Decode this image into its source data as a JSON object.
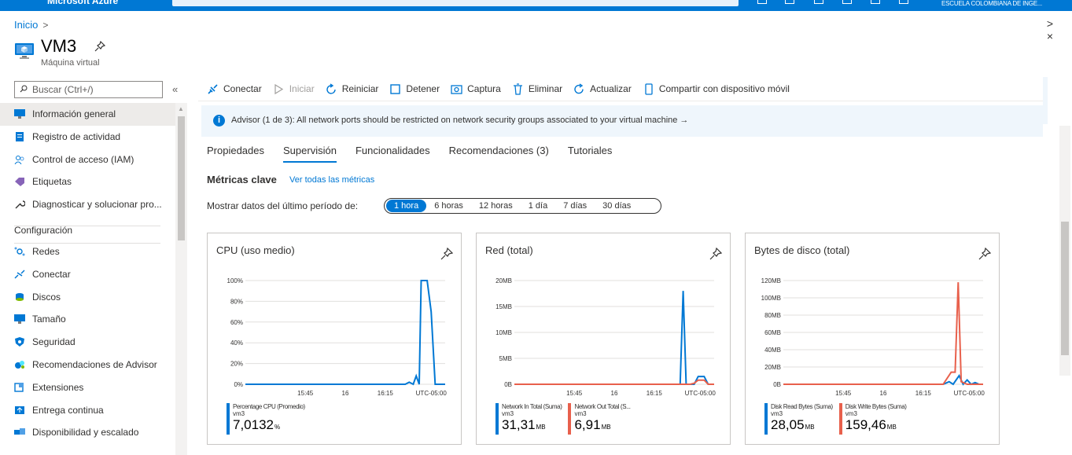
{
  "topbar": {
    "brand": "Microsoft Azure",
    "org": "ESCUELA COLOMBIANA DE INGE..."
  },
  "breadcrumb": {
    "home": "Inicio"
  },
  "header": {
    "title": "VM3",
    "subtitle": "Máquina virtual"
  },
  "sidebar": {
    "search_placeholder": "Buscar (Ctrl+/)",
    "items": [
      {
        "label": "Información general",
        "icon": "monitor-icon"
      },
      {
        "label": "Registro de actividad",
        "icon": "log-icon"
      },
      {
        "label": "Control de acceso (IAM)",
        "icon": "people-icon"
      },
      {
        "label": "Etiquetas",
        "icon": "tag-icon"
      },
      {
        "label": "Diagnosticar y solucionar pro...",
        "icon": "wrench-icon"
      }
    ],
    "section": "Configuración",
    "config_items": [
      {
        "label": "Redes",
        "icon": "network-icon"
      },
      {
        "label": "Conectar",
        "icon": "connect-icon"
      },
      {
        "label": "Discos",
        "icon": "disks-icon"
      },
      {
        "label": "Tamaño",
        "icon": "size-icon"
      },
      {
        "label": "Seguridad",
        "icon": "shield-icon"
      },
      {
        "label": "Recomendaciones de Advisor",
        "icon": "advisor-icon"
      },
      {
        "label": "Extensiones",
        "icon": "extensions-icon"
      },
      {
        "label": "Entrega continua",
        "icon": "delivery-icon"
      },
      {
        "label": "Disponibilidad y escalado",
        "icon": "scale-icon"
      }
    ]
  },
  "toolbar": {
    "connect": "Conectar",
    "start": "Iniciar",
    "restart": "Reiniciar",
    "stop": "Detener",
    "capture": "Captura",
    "delete": "Eliminar",
    "refresh": "Actualizar",
    "share": "Compartir con dispositivo móvil"
  },
  "banner": {
    "text": "Advisor (1 de 3): All network ports should be restricted on network security groups associated to your virtual machine →"
  },
  "tabs": [
    "Propiedades",
    "Supervisión",
    "Funcionalidades",
    "Recomendaciones (3)",
    "Tutoriales"
  ],
  "active_tab": 1,
  "metrics": {
    "title": "Métricas clave",
    "link": "Ver todas las métricas",
    "period_label": "Mostrar datos del último período de:"
  },
  "periods": [
    "1 hora",
    "6 horas",
    "12 horas",
    "1 día",
    "7 días",
    "30 días"
  ],
  "selected_period": 0,
  "colors": {
    "accent": "#0078d4",
    "series_blue": "#0078d4",
    "series_orange": "#e8604c"
  },
  "chart_data": [
    {
      "type": "line",
      "title": "CPU (uso medio)",
      "ylabels": [
        "100%",
        "80%",
        "60%",
        "40%",
        "20%",
        "0%"
      ],
      "xlabels": [
        "15:45",
        "16",
        "16:15",
        "UTC-05:00"
      ],
      "series": [
        {
          "name": "Percentage CPU (Promedio)",
          "sub": "vm3",
          "value": "7,0132",
          "unit": "%",
          "color": "#0078d4",
          "points": [
            [
              0,
              0
            ],
            [
              0.55,
              0
            ],
            [
              0.8,
              0
            ],
            [
              0.82,
              2
            ],
            [
              0.84,
              0
            ],
            [
              0.855,
              8
            ],
            [
              0.87,
              0
            ],
            [
              0.88,
              100
            ],
            [
              0.91,
              100
            ],
            [
              0.93,
              70
            ],
            [
              0.95,
              0
            ],
            [
              1,
              0
            ]
          ]
        }
      ]
    },
    {
      "type": "line",
      "title": "Red (total)",
      "ylabels": [
        "20MB",
        "15MB",
        "10MB",
        "5MB",
        "0B"
      ],
      "xlabels": [
        "15:45",
        "16",
        "16:15",
        "UTC-05:00"
      ],
      "series": [
        {
          "name": "Network In Total (Suma)",
          "sub": "vm3",
          "value": "31,31",
          "unit": "MB",
          "color": "#0078d4",
          "points": [
            [
              0,
              0
            ],
            [
              0.8,
              0
            ],
            [
              0.83,
              0
            ],
            [
              0.845,
              18
            ],
            [
              0.86,
              0
            ],
            [
              0.9,
              0
            ],
            [
              0.92,
              1.5
            ],
            [
              0.95,
              1.5
            ],
            [
              0.97,
              0
            ],
            [
              1,
              0
            ]
          ]
        },
        {
          "name": "Network Out Total (S...",
          "sub": "vm3",
          "value": "6,91",
          "unit": "MB",
          "color": "#e8604c",
          "points": [
            [
              0,
              0
            ],
            [
              0.88,
              0
            ],
            [
              0.9,
              0.2
            ],
            [
              0.92,
              0.8
            ],
            [
              0.95,
              0.8
            ],
            [
              0.97,
              0
            ],
            [
              1,
              0
            ]
          ]
        }
      ]
    },
    {
      "type": "line",
      "title": "Bytes de disco (total)",
      "ylabels": [
        "120MB",
        "100MB",
        "80MB",
        "60MB",
        "40MB",
        "20MB",
        "0B"
      ],
      "xlabels": [
        "15:45",
        "16",
        "16:15",
        "UTC-05:00"
      ],
      "series": [
        {
          "name": "Disk Read Bytes (Suma)",
          "sub": "vm3",
          "value": "28,05",
          "unit": "MB",
          "color": "#0078d4",
          "points": [
            [
              0,
              0
            ],
            [
              0.8,
              0
            ],
            [
              0.83,
              3
            ],
            [
              0.85,
              0
            ],
            [
              0.88,
              10
            ],
            [
              0.9,
              0
            ],
            [
              0.92,
              5
            ],
            [
              0.94,
              0
            ],
            [
              0.96,
              2
            ],
            [
              0.98,
              0
            ],
            [
              1,
              0
            ]
          ]
        },
        {
          "name": "Disk Write Bytes (Suma)",
          "sub": "vm3",
          "value": "159,46",
          "unit": "MB",
          "color": "#e8604c",
          "points": [
            [
              0,
              0
            ],
            [
              0.8,
              0
            ],
            [
              0.84,
              14
            ],
            [
              0.86,
              14
            ],
            [
              0.875,
              118
            ],
            [
              0.89,
              3
            ],
            [
              0.92,
              0
            ],
            [
              1,
              0
            ]
          ]
        }
      ]
    }
  ]
}
